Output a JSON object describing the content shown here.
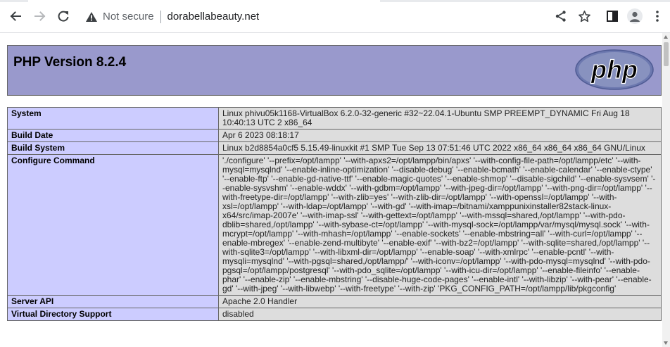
{
  "browser": {
    "security_label": "Not secure",
    "url": "dorabellabeauty.net",
    "icons": {
      "back": "arrow-left-icon",
      "forward": "arrow-right-icon",
      "reload": "reload-icon",
      "security": "warning-triangle-icon",
      "share": "share-icon",
      "bookmark": "star-icon",
      "side_panel": "side-panel-icon",
      "profile": "avatar-icon",
      "menu": "kebab-menu-icon"
    }
  },
  "php": {
    "title": "PHP Version 8.2.4",
    "logo_text": "php",
    "colors": {
      "header_bg": "#9999cc",
      "label_bg": "#ccccff",
      "value_bg": "#dddddd",
      "border": "#666666"
    },
    "rows": [
      {
        "label": "System",
        "value": "Linux phivu05k1168-VirtualBox 6.2.0-32-generic #32~22.04.1-Ubuntu SMP PREEMPT_DYNAMIC Fri Aug 18 10:40:13 UTC 2 x86_64"
      },
      {
        "label": "Build Date",
        "value": "Apr 6 2023 08:18:17"
      },
      {
        "label": "Build System",
        "value": "Linux b2d8854a0cf5 5.15.49-linuxkit #1 SMP Tue Sep 13 07:51:46 UTC 2022 x86_64 x86_64 x86_64 GNU/Linux"
      },
      {
        "label": "Configure Command",
        "value": "'./configure' '--prefix=/opt/lampp' '--with-apxs2=/opt/lampp/bin/apxs' '--with-config-file-path=/opt/lampp/etc' '--with-mysql=mysqlnd' '--enable-inline-optimization' '--disable-debug' '--enable-bcmath' '--enable-calendar' '--enable-ctype' '--enable-ftp' '--enable-gd-native-ttf' '--enable-magic-quotes' '--enable-shmop' '--disable-sigchild' '--enable-sysvsem' '--enable-sysvshm' '--enable-wddx' '--with-gdbm=/opt/lampp' '--with-jpeg-dir=/opt/lampp' '--with-png-dir=/opt/lampp' '--with-freetype-dir=/opt/lampp' '--with-zlib=yes' '--with-zlib-dir=/opt/lampp' '--with-openssl=/opt/lampp' '--with-xsl=/opt/lampp' '--with-ldap=/opt/lampp' '--with-gd' '--with-imap=/bitnami/xamppunixinstaller82stack-linux-x64/src/imap-2007e' '--with-imap-ssl' '--with-gettext=/opt/lampp' '--with-mssql=shared,/opt/lampp' '--with-pdo-dblib=shared,/opt/lampp' '--with-sybase-ct=/opt/lampp' '--with-mysql-sock=/opt/lampp/var/mysql/mysql.sock' '--with-mcrypt=/opt/lampp' '--with-mhash=/opt/lampp' '--enable-sockets' '--enable-mbstring=all' '--with-curl=/opt/lampp' '--enable-mbregex' '--enable-zend-multibyte' '--enable-exif' '--with-bz2=/opt/lampp' '--with-sqlite=shared,/opt/lampp' '--with-sqlite3=/opt/lampp' '--with-libxml-dir=/opt/lampp' '--enable-soap' '--with-xmlrpc' '--enable-pcntl' '--with-mysqli=mysqlnd' '--with-pgsql=shared,/opt/lampp/' '--with-iconv=/opt/lampp' '--with-pdo-mysql=mysqlnd' '--with-pdo-pgsql=/opt/lampp/postgresql' '--with-pdo_sqlite=/opt/lampp' '--with-icu-dir=/opt/lampp' '--enable-fileinfo' '--enable-phar' '--enable-zip' '--enable-mbstring' '--disable-huge-code-pages' '--enable-intl' '--with-libzip' '--with-pear' '--enable-gd' '--with-jpeg' '--with-libwebp' '--with-freetype' '--with-zip' 'PKG_CONFIG_PATH=/opt/lampp/lib/pkgconfig'"
      },
      {
        "label": "Server API",
        "value": "Apache 2.0 Handler"
      },
      {
        "label": "Virtual Directory Support",
        "value": "disabled"
      }
    ]
  }
}
